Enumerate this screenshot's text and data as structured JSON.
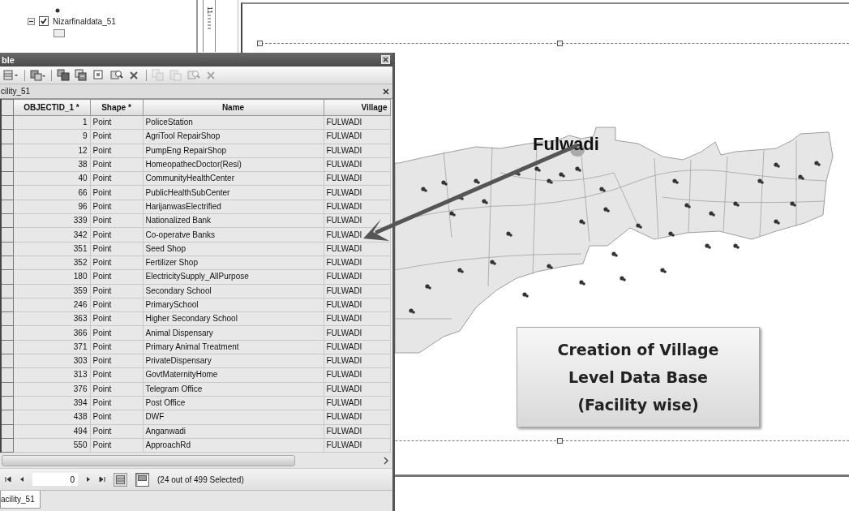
{
  "toc": {
    "layer": {
      "name": "Nizarfinaldata_51",
      "checked": true,
      "expanded": true
    }
  },
  "ruler": {
    "label": "11"
  },
  "layout": {
    "map_label": "Fulwadi",
    "callout": "Creation of Village\nLevel Data Base\n(Facility wise)"
  },
  "table_window": {
    "title": "ble",
    "toolbar": [
      {
        "kind": "options",
        "disabled": false
      },
      {
        "kind": "related",
        "disabled": false
      },
      {
        "kind": "select",
        "disabled": false
      },
      {
        "kind": "switch",
        "disabled": false
      },
      {
        "kind": "clear",
        "disabled": false
      },
      {
        "kind": "zoom",
        "disabled": false
      },
      {
        "kind": "delete",
        "disabled": false
      },
      {
        "kind": "copy",
        "disabled": true
      },
      {
        "kind": "paste",
        "disabled": true
      },
      {
        "kind": "zoom",
        "disabled": true
      },
      {
        "kind": "delete",
        "disabled": true
      }
    ],
    "tab": "cility_51",
    "columns": [
      "OBJECTID_1 *",
      "Shape *",
      "Name",
      "Village"
    ],
    "rows": [
      {
        "objectid": "1",
        "shape": "Point",
        "name": "PoliceStation",
        "village": "FULWADI"
      },
      {
        "objectid": "9",
        "shape": "Point",
        "name": "AgriTool RepairShop",
        "village": "FULWADI"
      },
      {
        "objectid": "12",
        "shape": "Point",
        "name": "PumpEng RepairShop",
        "village": "FULWADI"
      },
      {
        "objectid": "38",
        "shape": "Point",
        "name": "HomeopathecDoctor(Resi)",
        "village": "FULWADI"
      },
      {
        "objectid": "40",
        "shape": "Point",
        "name": "CommunityHealthCenter",
        "village": "FULWADI"
      },
      {
        "objectid": "66",
        "shape": "Point",
        "name": "PublicHealthSubCenter",
        "village": "FULWADI"
      },
      {
        "objectid": "96",
        "shape": "Point",
        "name": "HarijanwasElectrified",
        "village": "FULWADI"
      },
      {
        "objectid": "339",
        "shape": "Point",
        "name": "Nationalized Bank",
        "village": "FULWADI"
      },
      {
        "objectid": "342",
        "shape": "Point",
        "name": "Co-operatve Banks",
        "village": "FULWADI"
      },
      {
        "objectid": "351",
        "shape": "Point",
        "name": "Seed Shop",
        "village": "FULWADI"
      },
      {
        "objectid": "352",
        "shape": "Point",
        "name": "Fertilizer Shop",
        "village": "FULWADI"
      },
      {
        "objectid": "180",
        "shape": "Point",
        "name": "ElectricitySupply_AllPurpose",
        "village": "FULWADI"
      },
      {
        "objectid": "359",
        "shape": "Point",
        "name": "Secondary School",
        "village": "FULWADI"
      },
      {
        "objectid": "246",
        "shape": "Point",
        "name": "PrimarySchool",
        "village": "FULWADI"
      },
      {
        "objectid": "363",
        "shape": "Point",
        "name": "Higher Secondary School",
        "village": "FULWADI"
      },
      {
        "objectid": "366",
        "shape": "Point",
        "name": "Animal Dispensary",
        "village": "FULWADI"
      },
      {
        "objectid": "371",
        "shape": "Point",
        "name": "Primary Animal Treatment",
        "village": "FULWADI"
      },
      {
        "objectid": "303",
        "shape": "Point",
        "name": "PrivateDispensary",
        "village": "FULWADI"
      },
      {
        "objectid": "313",
        "shape": "Point",
        "name": "GovtMaternityHome",
        "village": "FULWADI"
      },
      {
        "objectid": "376",
        "shape": "Point",
        "name": "Telegram Office",
        "village": "FULWADI"
      },
      {
        "objectid": "394",
        "shape": "Point",
        "name": "Post Office",
        "village": "FULWADI"
      },
      {
        "objectid": "438",
        "shape": "Point",
        "name": "DWF",
        "village": "FULWADI"
      },
      {
        "objectid": "494",
        "shape": "Point",
        "name": "Anganwadi",
        "village": "FULWADI"
      },
      {
        "objectid": "550",
        "shape": "Point",
        "name": "ApproachRd",
        "village": "FULWADI"
      }
    ],
    "record": "0",
    "view_buttons": [
      {
        "selected": false
      },
      {
        "selected": true
      }
    ],
    "status": "(24 out of 499 Selected)",
    "bottom_tab": "acility_51"
  }
}
